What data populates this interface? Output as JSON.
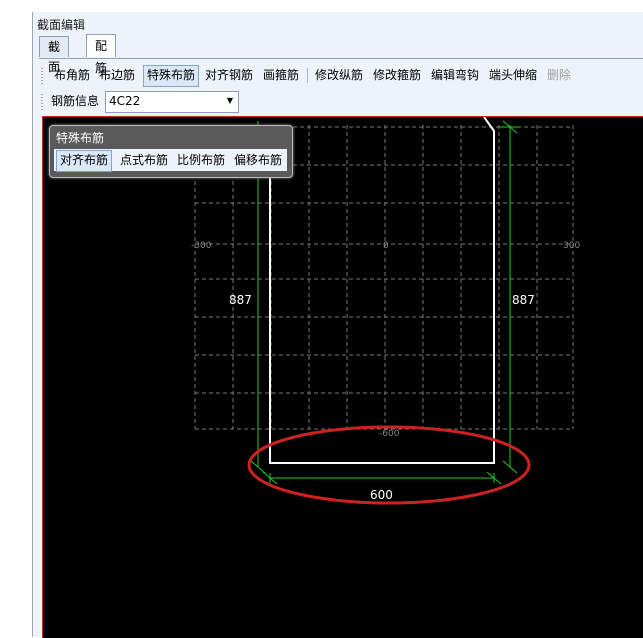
{
  "window": {
    "title": "截面编辑"
  },
  "tabs": [
    {
      "label": "截面"
    },
    {
      "label": "配筋"
    }
  ],
  "toolbar": {
    "buttons": [
      {
        "label": "布角筋"
      },
      {
        "label": "布边筋"
      },
      {
        "label": "特殊布筋"
      },
      {
        "label": "对齐钢筋"
      },
      {
        "label": "画箍筋"
      },
      {
        "label": "修改纵筋"
      },
      {
        "label": "修改箍筋"
      },
      {
        "label": "编辑弯钩"
      },
      {
        "label": "端头伸缩"
      },
      {
        "label": "删除"
      }
    ]
  },
  "rebar_info": {
    "label": "钢筋信息",
    "value": "4C22"
  },
  "special_popup": {
    "title": "特殊布筋",
    "buttons": [
      {
        "label": "对齐布筋"
      },
      {
        "label": "点式布筋"
      },
      {
        "label": "比例布筋"
      },
      {
        "label": "偏移布筋"
      }
    ]
  },
  "drawing": {
    "axis_labels": {
      "left": "-300",
      "center": "0",
      "right": "300",
      "bottom": "-600"
    },
    "dim_left": "887",
    "dim_right": "887",
    "dim_bottom": "600"
  },
  "colors": {
    "accent": "#cc2222",
    "dim_line": "#22cc22",
    "outline": "#ffffff",
    "grid": "#777777"
  }
}
